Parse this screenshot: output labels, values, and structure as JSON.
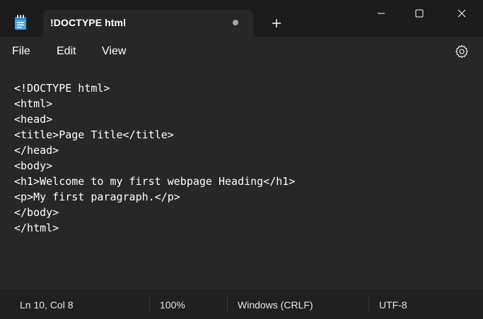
{
  "app": {
    "icon": "notepad-icon"
  },
  "tab": {
    "title": "!DOCTYPE html",
    "unsaved_indicator": "dot",
    "new_tab_icon": "plus-icon"
  },
  "window_controls": {
    "minimize": "minimize-icon",
    "maximize": "maximize-icon",
    "close": "close-icon"
  },
  "menu": {
    "file": "File",
    "edit": "Edit",
    "view": "View",
    "settings_icon": "gear-icon"
  },
  "editor": {
    "lines": [
      "<!DOCTYPE html>",
      "<html>",
      "<head>",
      "<title>Page Title</title>",
      "</head>",
      "<body>",
      "<h1>Welcome to my first webpage Heading</h1>",
      "<p>My first paragraph.</p>",
      "</body>",
      "</html>"
    ]
  },
  "status": {
    "position": "Ln 10, Col 8",
    "zoom": "100%",
    "line_ending": "Windows (CRLF)",
    "encoding": "UTF-8"
  },
  "colors": {
    "titlebar_bg": "#1c1c1c",
    "editor_bg": "#272727",
    "statusbar_bg": "#202020",
    "text": "#ffffff",
    "app_icon_accent": "#4aa3df"
  }
}
